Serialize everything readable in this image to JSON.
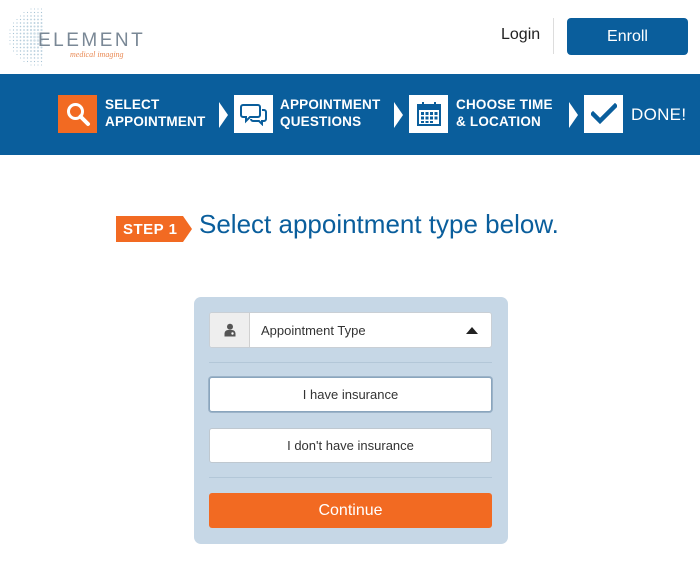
{
  "brand": {
    "name": "ELEMENT",
    "tagline": "medical imaging",
    "logo_color": "#7a8896",
    "tagline_color": "#e98a55"
  },
  "header": {
    "login_label": "Login",
    "enroll_label": "Enroll"
  },
  "steps": [
    {
      "label": "SELECT\nAPPOINTMENT",
      "icon": "search-icon",
      "state": "active"
    },
    {
      "label": "APPOINTMENT\nQUESTIONS",
      "icon": "chat-bubbles-icon",
      "state": "pending"
    },
    {
      "label": "CHOOSE TIME\n& LOCATION",
      "icon": "calendar-icon",
      "state": "pending"
    },
    {
      "label": "DONE!",
      "icon": "checkmark-icon",
      "state": "pending"
    }
  ],
  "heading": {
    "badge": "STEP 1",
    "title": "Select appointment type below."
  },
  "form": {
    "select_icon": "doctor-icon",
    "select_value": "Appointment Type",
    "option_insurance": "I have insurance",
    "option_no_insurance": "I don't have insurance",
    "continue_label": "Continue"
  },
  "colors": {
    "primary_blue": "#0a5e9c",
    "accent_orange": "#f26a22",
    "panel_bg": "#c6d7e6"
  }
}
